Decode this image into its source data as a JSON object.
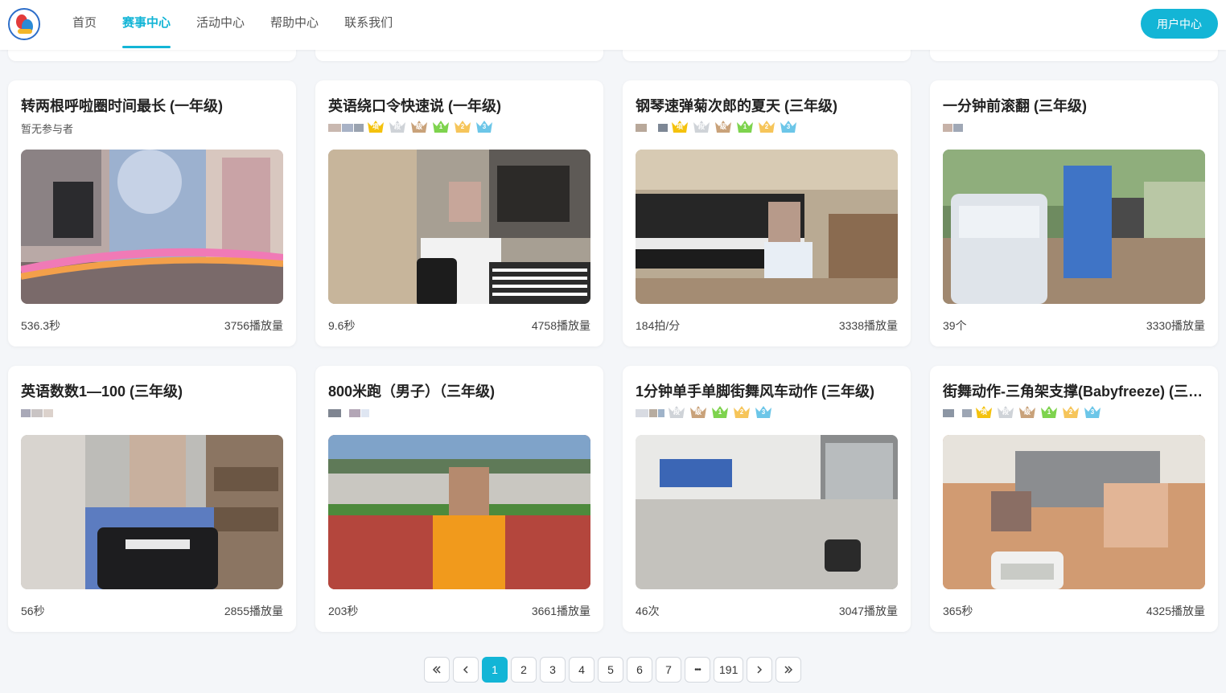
{
  "header": {
    "nav": [
      {
        "label": "首页",
        "active": false
      },
      {
        "label": "赛事中心",
        "active": true
      },
      {
        "label": "活动中心",
        "active": false
      },
      {
        "label": "帮助中心",
        "active": false
      },
      {
        "label": "联系我们",
        "active": false
      }
    ],
    "user_center_label": "用户中心",
    "logo_icon": "school-logo-icon"
  },
  "crowns": [
    {
      "char": "项",
      "color": "#f4c20d"
    },
    {
      "char": "段",
      "color": "#cfd3d8"
    },
    {
      "char": "级",
      "color": "#c9a27a"
    },
    {
      "char": "1",
      "color": "#7ed34e"
    },
    {
      "char": "2",
      "color": "#f6c55a"
    },
    {
      "char": "3",
      "color": "#6cc6e8"
    }
  ],
  "cards": [
    {
      "title": "转两根呼啦圈时间最长 (一年级)",
      "no_participants": "暂无参与者",
      "crown_start": -1,
      "score": "536.3秒",
      "views": "3756播放量",
      "thumb_icon": "hula-hoop-video-thumbnail"
    },
    {
      "title": "英语绕口令快速说 (一年级)",
      "no_participants": "",
      "crown_start": 0,
      "score": "9.6秒",
      "views": "4758播放量",
      "thumb_icon": "tongue-twister-video-thumbnail"
    },
    {
      "title": "钢琴速弹菊次郎的夏天 (三年级)",
      "no_participants": "",
      "crown_start": 0,
      "score": "184拍/分",
      "views": "3338播放量",
      "thumb_icon": "piano-video-thumbnail"
    },
    {
      "title": "一分钟前滚翻 (三年级)",
      "no_participants": "",
      "crown_start": -1,
      "score": "39个",
      "views": "3330播放量",
      "thumb_icon": "cartwheel-video-thumbnail"
    },
    {
      "title": "英语数数1—100 (三年级)",
      "no_participants": "",
      "crown_start": -1,
      "score": "56秒",
      "views": "2855播放量",
      "thumb_icon": "counting-video-thumbnail"
    },
    {
      "title": "800米跑（男子）（三年级)",
      "no_participants": "",
      "crown_start": -1,
      "score": "203秒",
      "views": "3661播放量",
      "thumb_icon": "running-track-video-thumbnail"
    },
    {
      "title": "1分钟单手单脚街舞风车动作 (三年级)",
      "no_participants": "",
      "crown_start": 1,
      "score": "46次",
      "views": "3047播放量",
      "thumb_icon": "breakdance-video-thumbnail"
    },
    {
      "title": "街舞动作-三角架支撑(Babyfreeze) (三年级)",
      "no_participants": "",
      "crown_start": 0,
      "score": "365秒",
      "views": "4325播放量",
      "thumb_icon": "babyfreeze-video-thumbnail"
    }
  ],
  "pagination": {
    "pages": [
      "1",
      "2",
      "3",
      "4",
      "5",
      "6",
      "7"
    ],
    "ellipsis": "•••",
    "last": "191",
    "current": "1"
  }
}
